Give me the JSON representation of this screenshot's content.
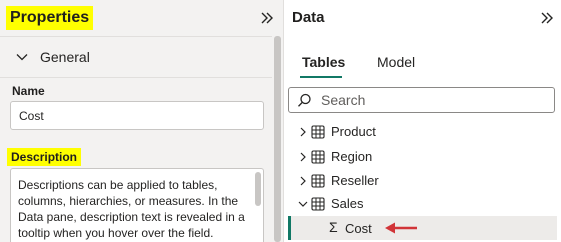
{
  "properties": {
    "title": "Properties",
    "collapse_icon": "double-chevron-right-icon",
    "section": {
      "label": "General",
      "icon": "chevron-down-icon"
    },
    "name": {
      "label": "Name",
      "value": "Cost"
    },
    "description": {
      "label": "Description",
      "text": "Descriptions can be applied to tables, columns, hierarchies, or measures. In the Data pane, description text is revealed in a tooltip when you hover over the field."
    },
    "highlight_color": "#ffff00"
  },
  "data_pane": {
    "title": "Data",
    "collapse_icon": "double-chevron-right-icon",
    "tabs": [
      {
        "label": "Tables",
        "active": true
      },
      {
        "label": "Model",
        "active": false
      }
    ],
    "search": {
      "placeholder": "Search",
      "icon": "search-icon"
    },
    "tables": [
      {
        "name": "Product",
        "expanded": false,
        "icon": "table-icon"
      },
      {
        "name": "Region",
        "expanded": false,
        "icon": "table-icon"
      },
      {
        "name": "Reseller",
        "expanded": false,
        "icon": "table-icon"
      },
      {
        "name": "Sales",
        "expanded": true,
        "icon": "table-icon"
      }
    ],
    "selected_field": {
      "name": "Cost",
      "icon": "sigma-icon"
    },
    "accent_color": "#117865",
    "annotation_arrow_color": "#d13438"
  }
}
